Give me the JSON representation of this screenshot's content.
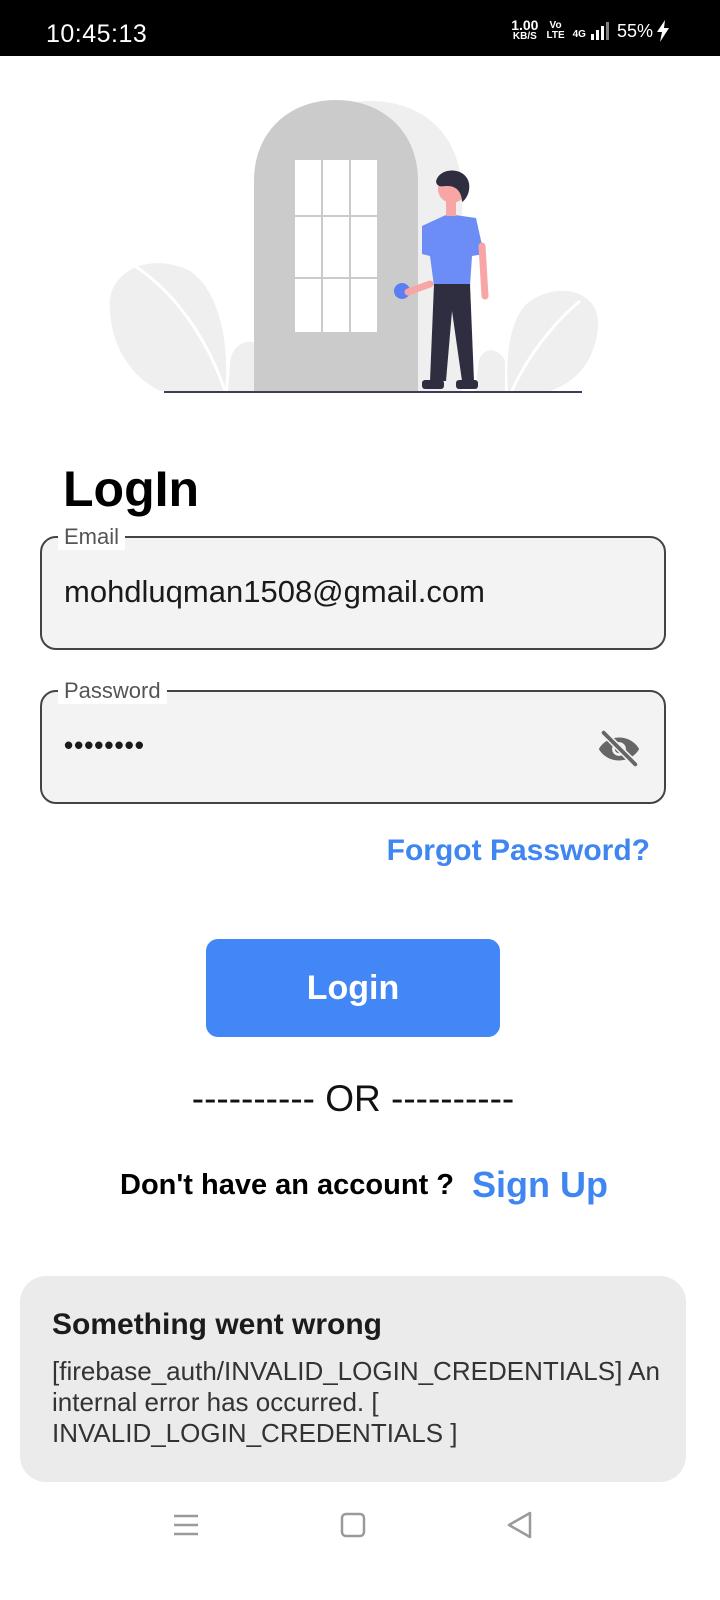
{
  "status_bar": {
    "time": "10:45:13",
    "speed_value": "1.00",
    "speed_unit": "KB/S",
    "volte_top": "Vo",
    "volte_bottom": "LTE",
    "network": "4G",
    "battery": "55%"
  },
  "login": {
    "title": "LogIn",
    "email_label": "Email",
    "email_value": "mohdluqman1508@gmail.com",
    "password_label": "Password",
    "password_masked": "••••••••",
    "password_toggle_icon": "eye-off-icon",
    "forgot_link": "Forgot Password?",
    "login_button": "Login",
    "or_divider": "---------- OR ----------",
    "signup_prompt": "Don't have an account ?",
    "signup_link": "Sign Up"
  },
  "error_toast": {
    "title": "Something went wrong",
    "message": "[firebase_auth/INVALID_LOGIN_CREDENTIALS] An internal error has occurred. [ INVALID_LOGIN_CREDENTIALS ]"
  },
  "nav": {
    "menu_icon": "menu-icon",
    "home_icon": "home-square-icon",
    "back_icon": "back-triangle-icon"
  },
  "colors": {
    "accent": "#4386f6",
    "link": "#3f86f0",
    "status_bar_bg": "#000000",
    "field_bg": "#f3f3f3",
    "toast_bg": "#ebebeb"
  }
}
